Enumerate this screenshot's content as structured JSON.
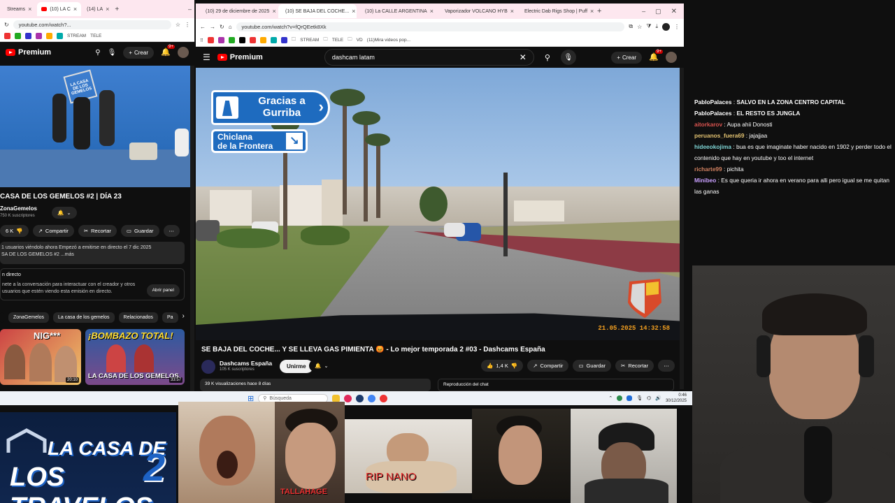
{
  "left_window": {
    "tabs": [
      {
        "label": "Streams",
        "active": false
      },
      {
        "label": "(10) LA C",
        "active": true
      },
      {
        "label": "(14) LA",
        "active": false
      }
    ],
    "url": "youtube.com/watch?...",
    "bookmarks": [
      "STREAM",
      "TELE"
    ],
    "yt": {
      "logo": "Premium",
      "create_label": "Crear",
      "notif_count": "9+",
      "video_title": "CASA DE LOS GEMELOS #2 | DÍA 23",
      "channel": "ZonaGemelos",
      "subscribers": "750 K suscriptores",
      "likes": "6 K",
      "share": "Compartir",
      "clip": "Recortar",
      "save": "Guardar",
      "desc_line1": "1 usuarios viéndolo ahora  Empezó a emitirse en directo el 7 dic 2025",
      "desc_line2": "SA DE LOS GEMELOS #2 ...más",
      "chat_heading": "n directo",
      "chat_text1": "nete a la conversación para interactuar con el creador y otros",
      "chat_text2": "usuarios que estén viendo esta emisión en directo.",
      "open_panel": "Abrir panel",
      "chips": [
        "ZonaGemelos",
        "La casa de los gemelos",
        "Relacionados",
        "Pa"
      ],
      "rec1_duration": "20:10",
      "rec2_title": "¡BOMBAZO TOTAL!",
      "rec2_caption": "LA CASA DE LOS GEMELOS",
      "rec2_duration": "33:57",
      "rec1_caption": "NIG***"
    }
  },
  "right_window": {
    "tabs": [
      {
        "label": "(10) 29 de diciembre de 2025",
        "active": false
      },
      {
        "label": "(10) SE BAJA DEL COCHE...",
        "active": true
      },
      {
        "label": "(10) La CALLE ARGENTINA",
        "active": false
      },
      {
        "label": "Vaporizador VOLCANO HYB",
        "active": false
      },
      {
        "label": "Electric Dab Rigs Shop | Puff",
        "active": false
      }
    ],
    "url": "youtube.com/watch?v=fQrQEetk8Xk",
    "bookmarks": [
      "STREAM",
      "TELE",
      "VD",
      "(11)Mira videos pop..."
    ],
    "yt": {
      "logo": "Premium",
      "search_value": "dashcam latam",
      "create_label": "Crear",
      "notif_count": "9+",
      "sign1_line1": "Gracias a",
      "sign1_line2": "Gurriba",
      "sign2_line1": "Chiclana",
      "sign2_line2": "de la Frontera",
      "video_timestamp": "21.05.2025 14:32:58",
      "video_title": "SE BAJA DEL COCHE... Y SE LLEVA GAS PIMIENTA 😡 - Lo mejor temporada 2 #03 - Dashcams España",
      "channel": "Dashcams España",
      "subscribers": "105 K suscriptores",
      "subscribe_label": "Unirme",
      "likes": "1,4 K",
      "share": "Compartir",
      "save": "Guardar",
      "clip": "Recortar",
      "views": "39 K visualizaciones  hace 8 días",
      "chat_replay": "Reproducción del chat"
    }
  },
  "taskbar": {
    "search_placeholder": "Búsqueda",
    "time": "0:46",
    "date": "30/12/2025"
  },
  "chat": [
    {
      "user": "PabloPalaces",
      "text": "SALVO EN LA ZONA CENTRO CAPITAL",
      "color": "#ffffff",
      "bold_text": true
    },
    {
      "user": "PabloPalaces",
      "text": "EL RESTO ES JUNGLA",
      "color": "#ffffff",
      "bold_text": true
    },
    {
      "user": "aitorkarov",
      "text": "Aupa ahii Donosti",
      "color": "#d9534f",
      "bold_text": false
    },
    {
      "user": "peruanos_fuera69",
      "text": "jajajjaa",
      "color": "#e0c070",
      "bold_text": false
    },
    {
      "user": "hideeokojima",
      "text": "bua es que imaginate haber nacido en 1902 y perder todo el contenido que hay en youtube y too el internet",
      "color": "#7fd6d6",
      "bold_text": false
    },
    {
      "user": "richarte99",
      "text": "pichita",
      "color": "#d08060",
      "bold_text": false
    },
    {
      "user": "Minibeo",
      "text": "Es que queria ir ahora en verano para alli pero igual se me quitan las ganas",
      "color": "#c9a0ff",
      "bold_text": false
    }
  ],
  "overlay": {
    "logo_line1": "LA CASA DE",
    "logo_line2": "LOS TRAVELOS",
    "logo_number": "2",
    "caption_tallahage": "TALLAHAGE",
    "caption_rip": "RIP NANO"
  }
}
